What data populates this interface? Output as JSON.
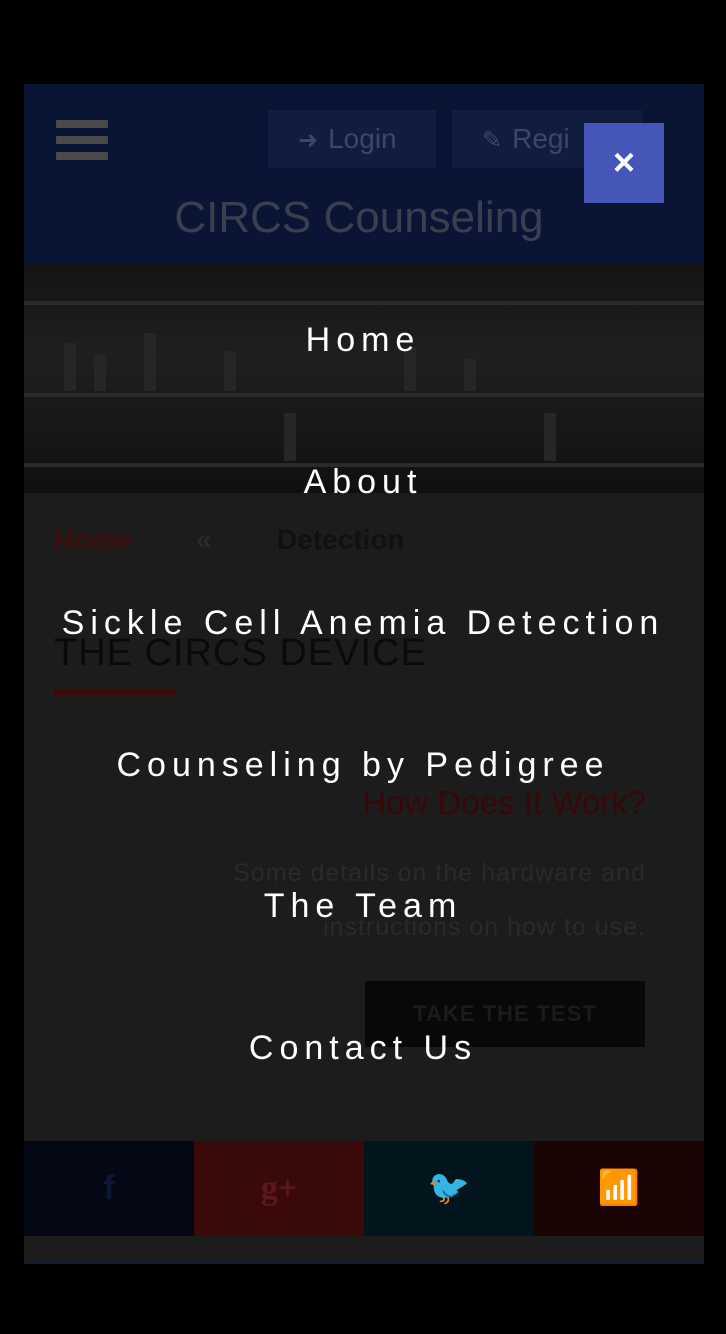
{
  "header": {
    "login_label": "Login",
    "register_label": "Regi",
    "site_title": "CIRCS Counseling"
  },
  "breadcrumb": {
    "home": "Home",
    "separator": "«",
    "current": "Detection"
  },
  "main": {
    "heading": "THE CIRCS DEVICE",
    "subheading": "How Does It Work?",
    "description": "Some details on the hardware and instructions on how to use.",
    "cta_label": "TAKE THE TEST"
  },
  "social": {
    "facebook": "f",
    "google_plus": "g+",
    "twitter": "🐦",
    "rss": "📶"
  },
  "overlay": {
    "close_glyph": "×",
    "items": [
      {
        "label": "Home"
      },
      {
        "label": "About"
      },
      {
        "label": "Sickle Cell Anemia Detection"
      },
      {
        "label": "Counseling by Pedigree"
      },
      {
        "label": "The Team"
      },
      {
        "label": "Contact Us"
      }
    ]
  },
  "colors": {
    "close_button": "#4556b8",
    "overlay_text": "#ffffff",
    "header_bg": "#0a1435",
    "accent_red": "#3d0808"
  },
  "icons": {
    "menu": "hamburger-icon",
    "login": "sign-in-icon",
    "register": "edit-icon",
    "close": "close-icon",
    "facebook": "facebook-icon",
    "google_plus": "google-plus-icon",
    "twitter": "twitter-icon",
    "rss": "rss-icon"
  }
}
